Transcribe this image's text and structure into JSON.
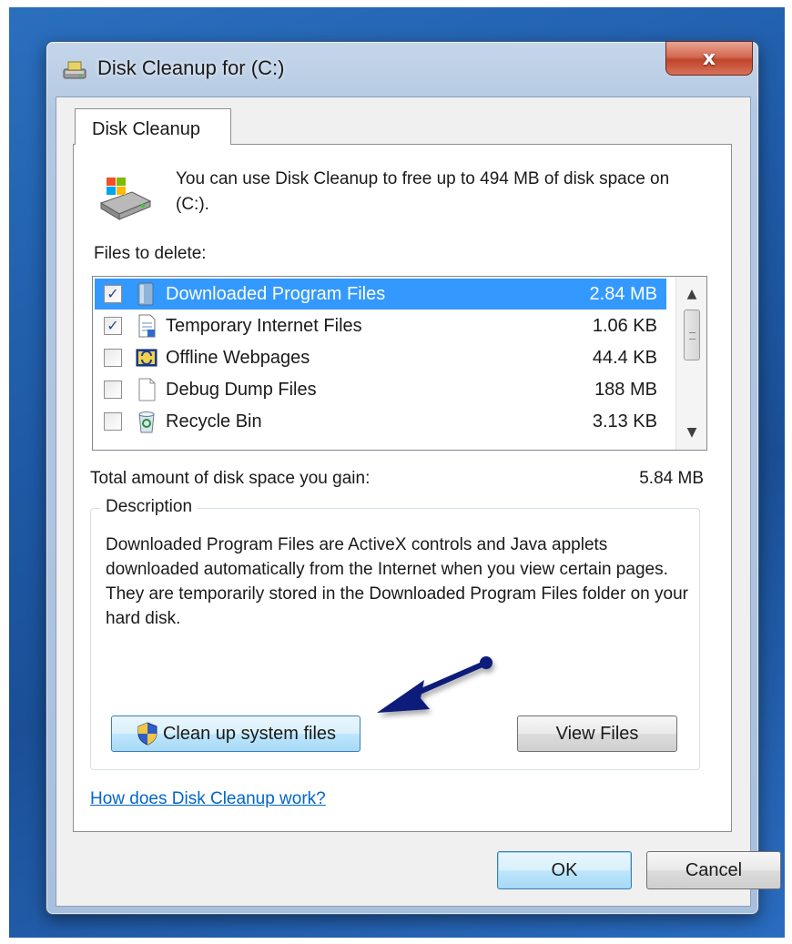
{
  "window": {
    "title": "Disk Cleanup for  (C:)",
    "close_label": "x"
  },
  "tab": {
    "label": "Disk Cleanup"
  },
  "intro": {
    "text": "You can use Disk Cleanup to free up to 494 MB of disk space on  (C:)."
  },
  "files": {
    "label": "Files to delete:",
    "items": [
      {
        "name": "Downloaded Program Files",
        "size": "2.84 MB",
        "checked": true,
        "selected": true,
        "icon": "folder-icon"
      },
      {
        "name": "Temporary Internet Files",
        "size": "1.06 KB",
        "checked": true,
        "selected": false,
        "icon": "document-icon"
      },
      {
        "name": "Offline Webpages",
        "size": "44.4 KB",
        "checked": false,
        "selected": false,
        "icon": "offline-webpages-icon"
      },
      {
        "name": "Debug Dump Files",
        "size": "188 MB",
        "checked": false,
        "selected": false,
        "icon": "blank-file-icon"
      },
      {
        "name": "Recycle Bin",
        "size": "3.13 KB",
        "checked": false,
        "selected": false,
        "icon": "recycle-bin-icon"
      }
    ]
  },
  "total": {
    "label": "Total amount of disk space you gain:",
    "value": "5.84 MB"
  },
  "description": {
    "legend": "Description",
    "text": "Downloaded Program Files are ActiveX controls and Java applets downloaded automatically from the Internet when you view certain pages. They are temporarily stored in the Downloaded Program Files folder on your hard disk."
  },
  "buttons": {
    "cleanup_system": "Clean up system files",
    "view_files": "View Files",
    "ok": "OK",
    "cancel": "Cancel"
  },
  "help": {
    "link": "How does Disk Cleanup work?"
  },
  "colors": {
    "selection": "#3399ff",
    "link": "#0066cc",
    "arrow": "#0b1e7a",
    "close": "#c0452b"
  }
}
